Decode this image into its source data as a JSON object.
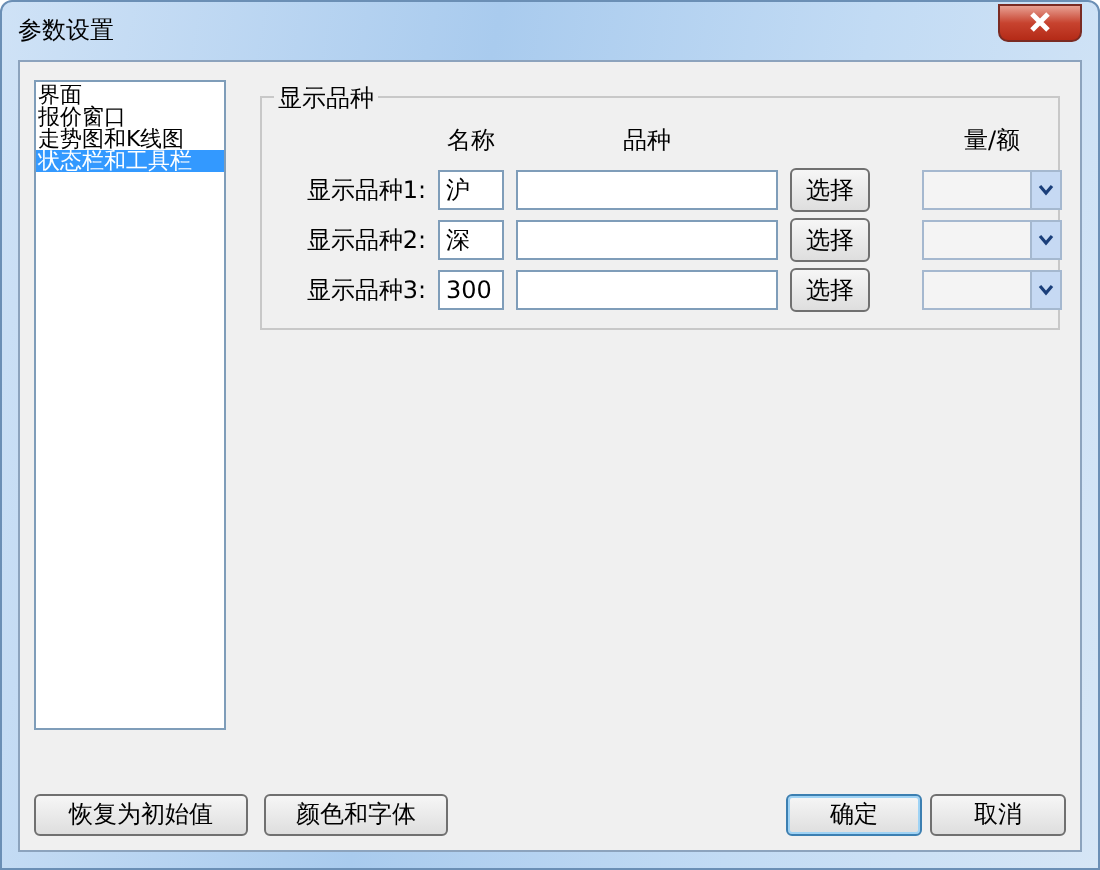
{
  "window": {
    "title": "参数设置"
  },
  "sidebar": {
    "items": [
      {
        "label": "界面",
        "selected": false
      },
      {
        "label": "报价窗口",
        "selected": false
      },
      {
        "label": "走势图和K线图",
        "selected": false
      },
      {
        "label": "状态栏和工具栏",
        "selected": true
      }
    ]
  },
  "group": {
    "title": "显示品种",
    "columns": [
      "名称",
      "品种",
      "量/额"
    ],
    "rows": [
      {
        "label": "显示品种1:",
        "name": "沪",
        "button": "选择"
      },
      {
        "label": "显示品种2:",
        "name": "深",
        "button": "选择"
      },
      {
        "label": "显示品种3:",
        "name": "300",
        "button": "选择"
      }
    ]
  },
  "buttons": [
    {
      "label": "恢复为初始值",
      "kind": "left"
    },
    {
      "label": "颜色和字体",
      "kind": "left"
    },
    {
      "label": "确定",
      "kind": "default"
    },
    {
      "label": "取消",
      "kind": "right"
    }
  ]
}
